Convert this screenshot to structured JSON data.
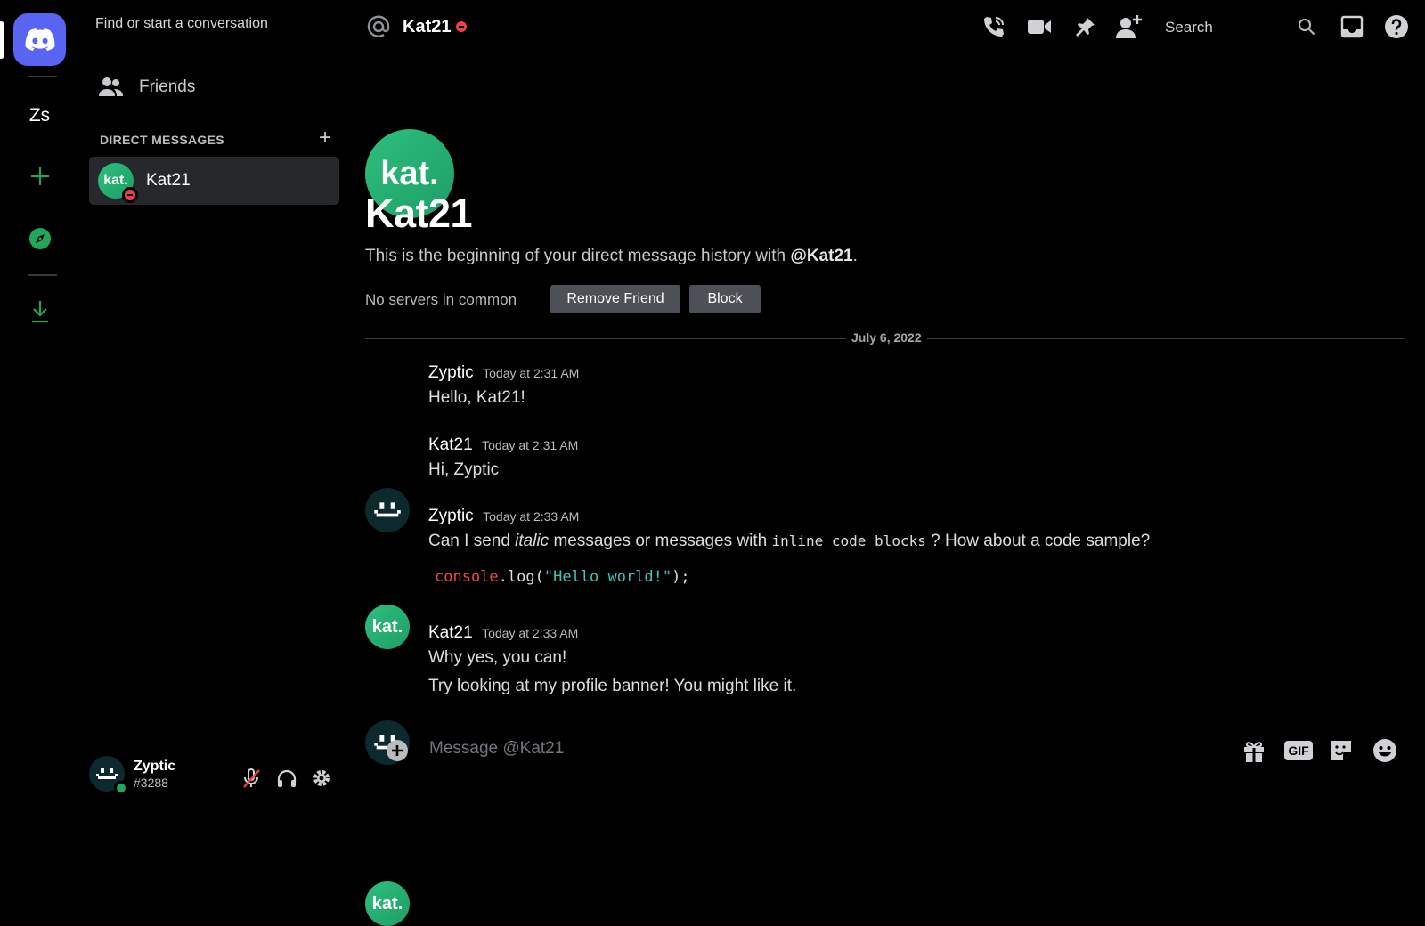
{
  "colors": {
    "accent": "#5865f2",
    "online": "#23a55a",
    "dnd": "#ed4245",
    "avatar_green": "#2dbf7e"
  },
  "rail": {
    "server_initials": "Zs",
    "icons": [
      "discord-logo-icon",
      "add-server-icon",
      "explore-compass-icon",
      "download-icon"
    ]
  },
  "sidebar": {
    "search_placeholder": "Find or start a conversation",
    "friends_label": "Friends",
    "dm_header": "DIRECT MESSAGES",
    "dm_add": "+",
    "dms": [
      {
        "name": "Kat21",
        "avatar_text": "kat.",
        "status": "dnd"
      }
    ]
  },
  "user_panel": {
    "name": "Zyptic",
    "tag": "#3288",
    "status": "online"
  },
  "header": {
    "name": "Kat21",
    "search_label": "Search",
    "icons": [
      "at-icon",
      "dnd-status-icon",
      "voice-call-icon",
      "video-call-icon",
      "pinned-icon",
      "add-friend-icon",
      "search-icon",
      "inbox-icon",
      "help-icon"
    ]
  },
  "welcome": {
    "avatar_text": "kat.",
    "title": "Kat21",
    "text_prefix": "This is the beginning of your direct message history with ",
    "text_handle": "@Kat21",
    "text_suffix": ".",
    "no_servers": "No servers in common",
    "remove_friend": "Remove Friend",
    "block": "Block"
  },
  "date_divider": "July 6, 2022",
  "messages": [
    {
      "author": "Zyptic",
      "time": "Today at 2:31 AM",
      "text": "Hello, Kat21!"
    },
    {
      "author": "Kat21",
      "time": "Today at 2:31 AM",
      "text": "Hi, Zyptic"
    },
    {
      "author": "Zyptic",
      "time": "Today at 2:33 AM",
      "parts": {
        "a": "Can I send ",
        "italic": "italic",
        "b": " messages or messages with ",
        "code": "inline code blocks",
        "c": " ? How about a code sample?"
      },
      "code_block": {
        "obj": "console",
        "call": ".log(",
        "str": "\"Hello world!\"",
        "end": ");"
      }
    },
    {
      "author": "Kat21",
      "time": "Today at 2:33 AM",
      "text": "Why yes, you can!",
      "text2": "Try looking at my profile banner! You might like it."
    }
  ],
  "composer": {
    "placeholder": "Message @Kat21",
    "gif_label": "GIF"
  }
}
